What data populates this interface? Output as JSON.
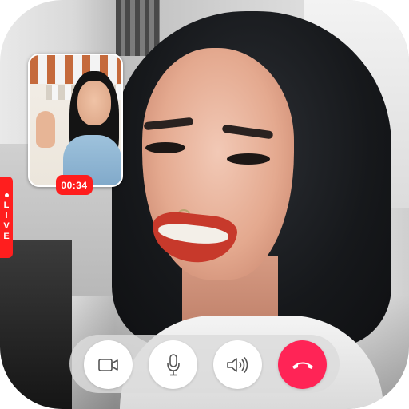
{
  "call": {
    "timer": "00:34",
    "live_label": [
      "L",
      "I",
      "V",
      "E"
    ]
  },
  "controls": [
    {
      "name": "video-camera-icon",
      "label": ""
    },
    {
      "name": "microphone-icon",
      "label": ""
    },
    {
      "name": "speaker-icon",
      "label": ""
    },
    {
      "name": "end-call-icon",
      "label": ""
    }
  ],
  "colors": {
    "live_badge": "#ff1e1e",
    "timer_badge": "#ff1d1d",
    "end_call": "#ff2456",
    "control_bar": "#dcdcdc",
    "control_button": "#ffffff",
    "icon_stroke": "#555555"
  }
}
